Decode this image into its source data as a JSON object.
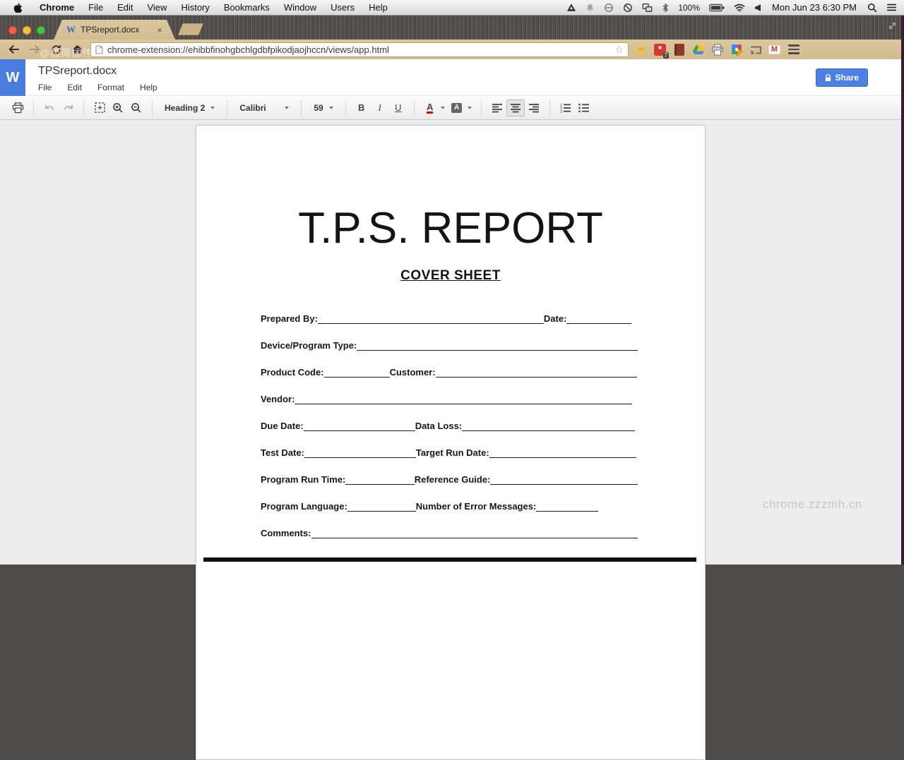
{
  "menubar": {
    "app_menu": "Chrome",
    "items": [
      "File",
      "Edit",
      "View",
      "History",
      "Bookmarks",
      "Window",
      "Users",
      "Help"
    ],
    "battery": "100%",
    "clock": "Mon Jun 23  6:30 PM"
  },
  "tabbar": {
    "title": "TPSreport.docx"
  },
  "addressbar": {
    "url": "chrome-extension://ehibbfinohgbchlgdbfpikodjaojhccn/views/app.html",
    "watermark": "@极简插件",
    "extension_badge": "7"
  },
  "app": {
    "title": "TPSreport.docx",
    "menu": [
      "File",
      "Edit",
      "Format",
      "Help"
    ],
    "share_label": "Share"
  },
  "toolbar": {
    "heading": "Heading 2",
    "font": "Calibri",
    "size": "59",
    "bold": "B",
    "italic": "I",
    "underline": "U",
    "color_letter": "A",
    "highlight_letter": "A"
  },
  "icons": {
    "close": "×",
    "star": "☆",
    "back": "←",
    "forward": "→",
    "favicon_w": "W",
    "w_logo": "W",
    "gmail_m": "M",
    "asterisk": "*"
  },
  "colors": {
    "accent_blue": "#4d80e4",
    "tab_tan": "#d5bf97",
    "word_blue": "#4a7ce0",
    "underline_red": "#cc0a00"
  },
  "document": {
    "title": "T.P.S. REPORT",
    "subtitle": "COVER SHEET",
    "rows": [
      [
        {
          "label": "Prepared By:",
          "line": 320
        },
        {
          "label": "Date:",
          "line": 92
        }
      ],
      [
        {
          "label": "Device/Program Type:",
          "line": 400
        }
      ],
      [
        {
          "label": "Product Code:",
          "line": 93
        },
        {
          "label": "Customer:",
          "line": 285
        }
      ],
      [
        {
          "label": "Vendor:",
          "line": 478
        }
      ],
      [
        {
          "label": "Due Date:",
          "line": 158
        },
        {
          "label": "Data Loss:",
          "line": 245
        }
      ],
      [
        {
          "label": "Test Date:",
          "line": 158
        },
        {
          "label": "Target Run Date:",
          "line": 208
        }
      ],
      [
        {
          "label": "Program Run Time:",
          "line": 98
        },
        {
          "label": "Reference Guide:",
          "line": 210
        }
      ],
      [
        {
          "label": "Program Language:",
          "line": 97
        },
        {
          "label": "Number of Error Messages:",
          "line": 88
        }
      ],
      [
        {
          "label": "Comments:",
          "line": 462
        }
      ]
    ]
  },
  "editor": {
    "watermark": "chrome.zzzmh.cn"
  }
}
